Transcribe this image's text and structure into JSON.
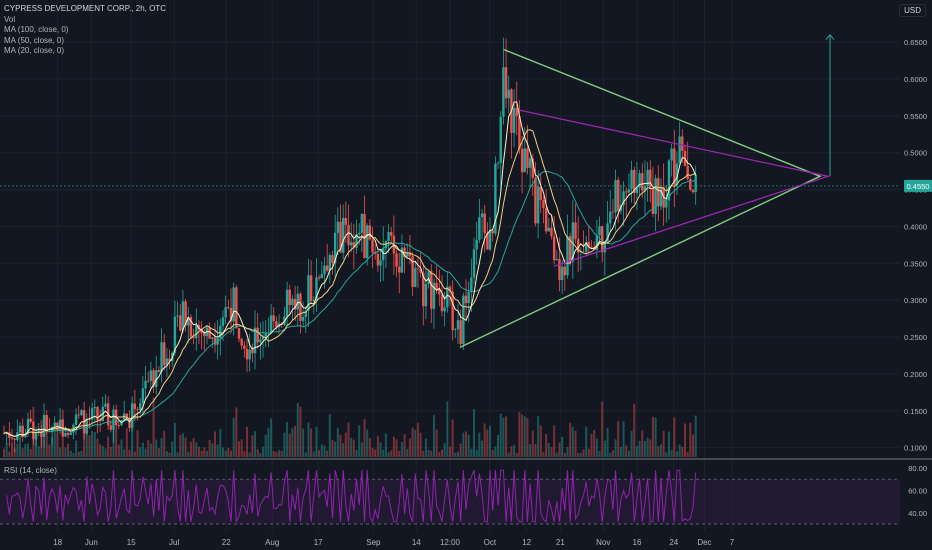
{
  "header": {
    "symbol_line": "CYPRESS DEVELOPMENT CORP., 2h, OTC",
    "indicators": [
      "Vol",
      "MA (100, close, 0)",
      "MA (50, close, 0)",
      "MA (20, close, 0)"
    ],
    "currency": "USD",
    "rsi_label": "RSI (14, close)"
  },
  "colors": {
    "background": "#131722",
    "grid": "#1e222d",
    "up": "#26a69a",
    "down": "#ef5350",
    "ma20": "#fff3c4",
    "ma50": "#f0d080",
    "ma100": "#26a69a",
    "triangle_outer": "#7fd17f",
    "triangle_inner": "#9c27b0",
    "rsi": "#8e24aa",
    "price_tag": "#26a69a"
  },
  "chart_data": {
    "type": "candlestick",
    "title": "CYPRESS DEVELOPMENT CORP., 2h, OTC",
    "y_ticks": [
      "0.6500",
      "0.6000",
      "0.5500",
      "0.5000",
      "0.4500",
      "0.4000",
      "0.3500",
      "0.3000",
      "0.2500",
      "0.2000",
      "0.1500",
      "0.1000"
    ],
    "ylim": [
      0.09,
      0.68
    ],
    "x_ticks": [
      "18",
      "Jun",
      "15",
      "Jul",
      "22",
      "Aug",
      "17",
      "Sep",
      "14",
      "12:00",
      "Oct",
      "12",
      "21",
      "Nov",
      "16",
      "24",
      "Dec",
      "7"
    ],
    "last_price": "0.4550",
    "price_path": [
      {
        "t": 0,
        "p": 0.12
      },
      {
        "t": 0.06,
        "p": 0.13
      },
      {
        "t": 0.12,
        "p": 0.14
      },
      {
        "t": 0.16,
        "p": 0.145
      },
      {
        "t": 0.19,
        "p": 0.2
      },
      {
        "t": 0.23,
        "p": 0.28
      },
      {
        "t": 0.26,
        "p": 0.25
      },
      {
        "t": 0.29,
        "p": 0.3
      },
      {
        "t": 0.31,
        "p": 0.24
      },
      {
        "t": 0.34,
        "p": 0.27
      },
      {
        "t": 0.36,
        "p": 0.29
      },
      {
        "t": 0.38,
        "p": 0.3
      },
      {
        "t": 0.41,
        "p": 0.36
      },
      {
        "t": 0.44,
        "p": 0.4
      },
      {
        "t": 0.47,
        "p": 0.38
      },
      {
        "t": 0.5,
        "p": 0.36
      },
      {
        "t": 0.53,
        "p": 0.32
      },
      {
        "t": 0.56,
        "p": 0.31
      },
      {
        "t": 0.58,
        "p": 0.25
      },
      {
        "t": 0.6,
        "p": 0.4
      },
      {
        "t": 0.62,
        "p": 0.38
      },
      {
        "t": 0.635,
        "p": 0.59
      },
      {
        "t": 0.66,
        "p": 0.5
      },
      {
        "t": 0.69,
        "p": 0.38
      },
      {
        "t": 0.71,
        "p": 0.35
      },
      {
        "t": 0.73,
        "p": 0.39
      },
      {
        "t": 0.75,
        "p": 0.37
      },
      {
        "t": 0.78,
        "p": 0.44
      },
      {
        "t": 0.81,
        "p": 0.48
      },
      {
        "t": 0.83,
        "p": 0.43
      },
      {
        "t": 0.86,
        "p": 0.5
      },
      {
        "t": 0.88,
        "p": 0.45
      }
    ],
    "rsi_ticks": [
      "80.00",
      "60.00",
      "40.00"
    ],
    "rsi_levels": [
      70,
      30
    ]
  }
}
